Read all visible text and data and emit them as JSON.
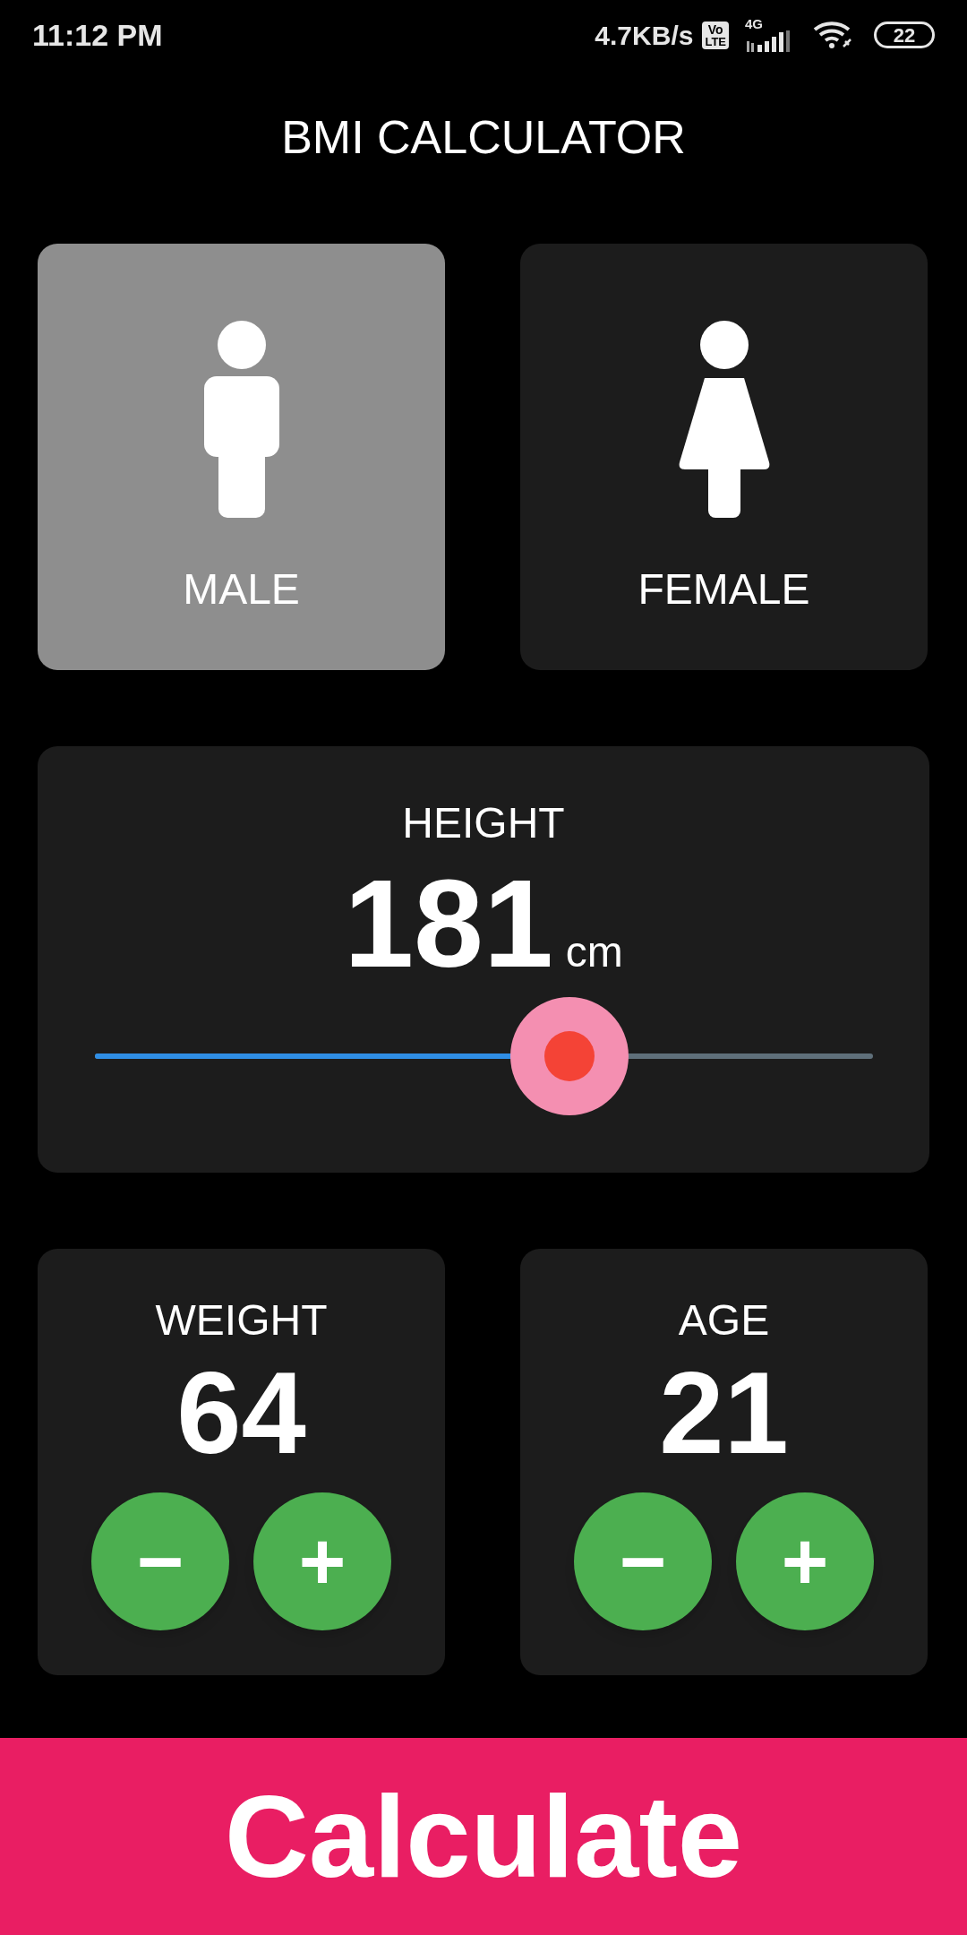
{
  "status_bar": {
    "time": "11:12 PM",
    "speed": "4.7KB/s",
    "volte_top": "Vo",
    "volte_bottom": "LTE",
    "network": "4G",
    "battery": "22"
  },
  "title": "BMI CALCULATOR",
  "genders": [
    {
      "label": "MALE",
      "kind": "male",
      "selected": true
    },
    {
      "label": "FEMALE",
      "kind": "female",
      "selected": false
    }
  ],
  "height": {
    "label": "HEIGHT",
    "value": "181",
    "unit": "cm",
    "level": 0.61
  },
  "counters": [
    {
      "label": "WEIGHT",
      "value": "64",
      "minus": "−",
      "plus": "+"
    },
    {
      "label": "AGE",
      "value": "21",
      "minus": "−",
      "plus": "+"
    }
  ],
  "calculate_button": "Calculate"
}
